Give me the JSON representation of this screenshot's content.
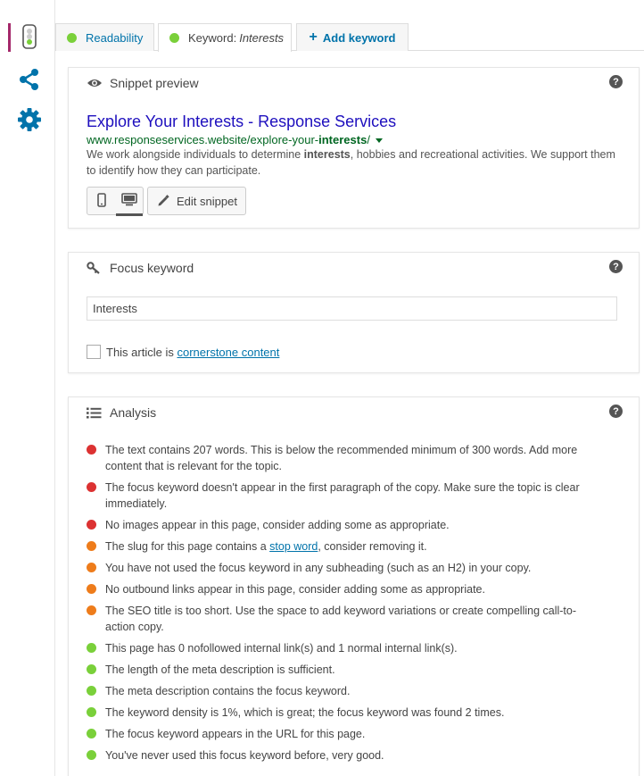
{
  "colors": {
    "bad": "#dc3232",
    "ok": "#ee7c1b",
    "good": "#7ad03a",
    "link": "#0073aa",
    "snippet_title": "#1e0fbe",
    "snippet_url": "#006621"
  },
  "rail": [
    {
      "icon": "traffic-light-icon",
      "active": true
    },
    {
      "icon": "share-icon"
    },
    {
      "icon": "gear-icon"
    }
  ],
  "tabs": {
    "readability": "Readability",
    "keyword_prefix": "Keyword:",
    "keyword_value": "Interests",
    "add": "Add keyword"
  },
  "snippet": {
    "heading": "Snippet preview",
    "title": "Explore Your Interests - Response Services",
    "url_plain": "www.responseservices.website/explore-your-",
    "url_bold": "interests",
    "url_end": "/",
    "desc_1": "We work alongside individuals to determine ",
    "desc_bold": "interests",
    "desc_2": ", hobbies and recreational activities. We support them to identify how they can participate.",
    "edit_label": "Edit snippet"
  },
  "focus": {
    "heading": "Focus keyword",
    "value": "Interests",
    "cornerstone_prefix": "This article is ",
    "cornerstone_link": "cornerstone content"
  },
  "analysis": {
    "heading": "Analysis",
    "stop_word_prefix": "The slug for this page contains a ",
    "stop_word_link": "stop word",
    "stop_word_suffix": ", consider removing it.",
    "items": [
      {
        "status": "bad",
        "text": "The text contains 207 words. This is below the recommended minimum of 300 words. Add more content that is relevant for the topic."
      },
      {
        "status": "bad",
        "text": "The focus keyword doesn't appear in the first paragraph of the copy. Make sure the topic is clear immediately."
      },
      {
        "status": "bad",
        "text": "No images appear in this page, consider adding some as appropriate."
      },
      {
        "status": "ok",
        "text": ""
      },
      {
        "status": "ok",
        "text": "You have not used the focus keyword in any subheading (such as an H2) in your copy."
      },
      {
        "status": "ok",
        "text": "No outbound links appear in this page, consider adding some as appropriate."
      },
      {
        "status": "ok",
        "text": "The SEO title is too short. Use the space to add keyword variations or create compelling call-to-action copy."
      },
      {
        "status": "good",
        "text": "This page has 0 nofollowed internal link(s) and 1 normal internal link(s)."
      },
      {
        "status": "good",
        "text": "The length of the meta description is sufficient."
      },
      {
        "status": "good",
        "text": "The meta description contains the focus keyword."
      },
      {
        "status": "good",
        "text": "The keyword density is 1%, which is great; the focus keyword was found 2 times."
      },
      {
        "status": "good",
        "text": "The focus keyword appears in the URL for this page."
      },
      {
        "status": "good",
        "text": "You've never used this focus keyword before, very good."
      }
    ]
  }
}
